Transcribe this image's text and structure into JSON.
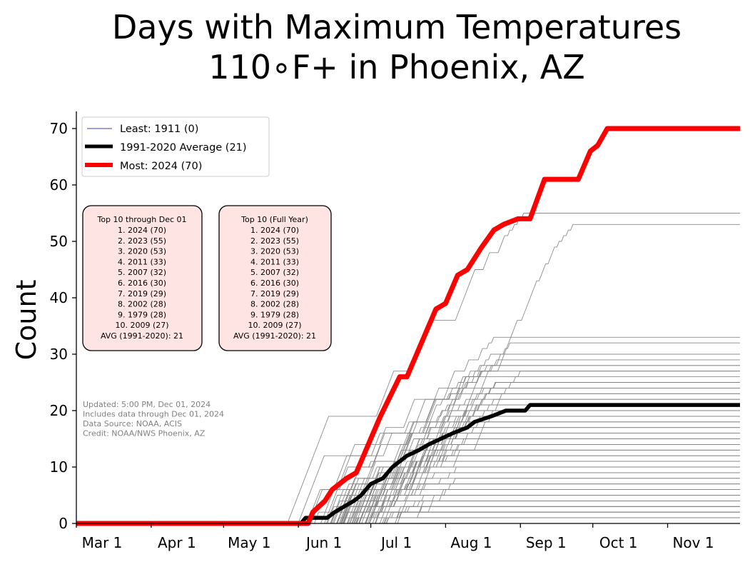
{
  "chart_data": {
    "type": "line",
    "title_lines": [
      "Days with Maximum Temperatures",
      "110∘F+ in Phoenix, AZ"
    ],
    "xlabel": "",
    "ylabel": "Count",
    "x_units": "days since Mar 1",
    "xlim": [
      0,
      275
    ],
    "ylim": [
      0,
      73
    ],
    "yticks": [
      0,
      10,
      20,
      30,
      40,
      50,
      60,
      70
    ],
    "xticks": [
      {
        "day": 0,
        "label": "Mar 1"
      },
      {
        "day": 31,
        "label": "Apr 1"
      },
      {
        "day": 61,
        "label": "May 1"
      },
      {
        "day": 92,
        "label": "Jun 1"
      },
      {
        "day": 122,
        "label": "Jul 1"
      },
      {
        "day": 153,
        "label": "Aug 1"
      },
      {
        "day": 184,
        "label": "Sep 1"
      },
      {
        "day": 214,
        "label": "Oct 1"
      },
      {
        "day": 245,
        "label": "Nov 1"
      }
    ],
    "grid": false,
    "legend": {
      "position": "top-left",
      "entries": [
        {
          "label": "Least: 1911 (0)",
          "color": "#000080",
          "style": "thin"
        },
        {
          "label": "1991-2020 Average (21)",
          "color": "#000000",
          "style": "thick"
        },
        {
          "label": "Most: 2024 (70)",
          "color": "#ff0000",
          "style": "thick"
        }
      ]
    },
    "series": [
      {
        "name": "Most: 2024 (70)",
        "color": "#ff0000",
        "points": [
          [
            0,
            0
          ],
          [
            96,
            0
          ],
          [
            98,
            2
          ],
          [
            103,
            4
          ],
          [
            106,
            6
          ],
          [
            112,
            8
          ],
          [
            116,
            9
          ],
          [
            121,
            14
          ],
          [
            126,
            19
          ],
          [
            134,
            26
          ],
          [
            137,
            26
          ],
          [
            149,
            38
          ],
          [
            153,
            39
          ],
          [
            158,
            44
          ],
          [
            162,
            45
          ],
          [
            168,
            49
          ],
          [
            173,
            52
          ],
          [
            177,
            53
          ],
          [
            183,
            54
          ],
          [
            188,
            54
          ],
          [
            194,
            61
          ],
          [
            208,
            61
          ],
          [
            213,
            66
          ],
          [
            216,
            67
          ],
          [
            220,
            70
          ],
          [
            275,
            70
          ]
        ]
      },
      {
        "name": "1991-2020 Average (21)",
        "color": "#000000",
        "points": [
          [
            0,
            0
          ],
          [
            93,
            0
          ],
          [
            95,
            1
          ],
          [
            104,
            1
          ],
          [
            107,
            2
          ],
          [
            111,
            3
          ],
          [
            115,
            4
          ],
          [
            118,
            5
          ],
          [
            122,
            7
          ],
          [
            127,
            8
          ],
          [
            131,
            10
          ],
          [
            137,
            12
          ],
          [
            142,
            13
          ],
          [
            146,
            14
          ],
          [
            151,
            15
          ],
          [
            156,
            16
          ],
          [
            162,
            17
          ],
          [
            165,
            18
          ],
          [
            172,
            19
          ],
          [
            178,
            20
          ],
          [
            186,
            20
          ],
          [
            188,
            21
          ],
          [
            275,
            21
          ]
        ]
      },
      {
        "name": "Least: 1911 (0)",
        "color": "#000080",
        "points": [
          [
            0,
            0
          ],
          [
            275,
            0
          ]
        ]
      }
    ],
    "background_years": {
      "color": "#808080",
      "note": "other years shown as thin gray cumulative step lines",
      "final_counts": [
        55,
        53,
        33,
        32,
        30,
        29,
        28,
        28,
        27,
        27,
        26,
        25,
        25,
        24,
        24,
        23,
        23,
        22,
        22,
        21,
        21,
        20,
        20,
        19,
        19,
        18,
        18,
        17,
        17,
        16,
        16,
        15,
        15,
        14,
        14,
        13,
        13,
        12,
        12,
        11,
        11,
        10,
        10,
        9,
        9,
        8,
        8,
        7,
        7,
        6,
        6,
        5,
        5,
        4,
        4,
        4,
        3,
        3,
        3,
        2,
        2,
        2,
        1,
        1,
        1,
        0
      ],
      "start_days": [
        72,
        92,
        80,
        88,
        85,
        90,
        84,
        89,
        86,
        93,
        82,
        90,
        95,
        87,
        91,
        97,
        85,
        94,
        99,
        83,
        96,
        88,
        100,
        92,
        98,
        90,
        103,
        87,
        95,
        101,
        89,
        104,
        93,
        97,
        106,
        86,
        100,
        95,
        108,
        91,
        102,
        96,
        110,
        94,
        104,
        98,
        112,
        97,
        106,
        100,
        115,
        99,
        109,
        103,
        118,
        101,
        112,
        106,
        120,
        104,
        115,
        109,
        108,
        118,
        125,
        0
      ]
    }
  },
  "legend_labels": {
    "least": "Least: 1911 (0)",
    "average": "1991-2020 Average (21)",
    "most": "Most: 2024 (70)"
  },
  "top10_through_date": {
    "title": "Top 10 through Dec 01",
    "items": [
      "1. 2024 (70)",
      "2. 2023 (55)",
      "3. 2020 (53)",
      "4. 2011 (33)",
      "5. 2007 (32)",
      "6. 2016 (30)",
      "7. 2019 (29)",
      "8. 2002 (28)",
      "9. 1979 (28)",
      "10. 2009 (27)"
    ],
    "avg": "AVG (1991-2020): 21"
  },
  "top10_full_year": {
    "title": "Top 10 (Full Year)",
    "items": [
      "1. 2024 (70)",
      "2. 2023 (55)",
      "3. 2020 (53)",
      "4. 2011 (33)",
      "5. 2007 (32)",
      "6. 2016 (30)",
      "7. 2019 (29)",
      "8. 2002 (28)",
      "9. 1979 (28)",
      "10. 2009 (27)"
    ],
    "avg": "AVG (1991-2020): 21"
  },
  "notes": [
    "Updated: 5:00 PM, Dec 01, 2024",
    "Includes data through Dec 01, 2024",
    "Data Source: NOAA, ACIS",
    "Credit: NOAA/NWS Phoenix, AZ"
  ],
  "colors": {
    "box_fill": "#ffe4e4",
    "box_stroke": "#000000",
    "note_text": "#808080",
    "gray_line": "#808080"
  }
}
